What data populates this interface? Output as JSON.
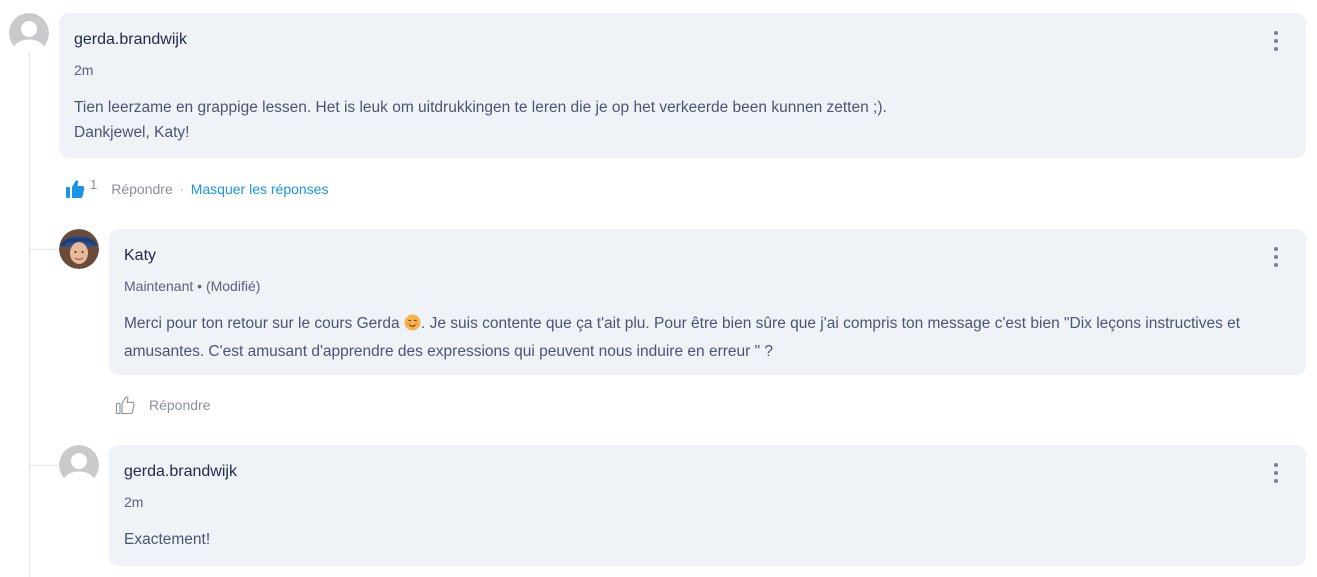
{
  "comments": [
    {
      "author": "gerda.brandwijk",
      "time": "2m",
      "text_line1": "Tien leerzame en grappige lessen. Het is leuk om uitdrukkingen te leren die je op het verkeerde been kunnen zetten ;).",
      "text_line2": "Dankjewel, Katy!",
      "like_count": "1",
      "reply_label": "Répondre",
      "separator": "·",
      "hide_replies_label": "Masquer les réponses"
    },
    {
      "author": "Katy",
      "time": "Maintenant • (Modifié)",
      "text_before_emoji": "Merci pour ton retour sur le cours Gerda ",
      "emoji": "smiling-face-emoji",
      "text_after_emoji": ". Je suis contente que ça t'ait plu. Pour être bien sûre que j'ai compris ton message c'est bien \"Dix leçons instructives et amusantes. C'est amusant d'apprendre des expressions qui peuvent nous induire en erreur \" ?",
      "reply_label": "Répondre"
    },
    {
      "author": "gerda.brandwijk",
      "time": "2m",
      "text": "Exactement!"
    }
  ],
  "colors": {
    "bubble": "#eff2f7",
    "link": "#1a93e8",
    "like_active": "#1a93e8",
    "muted": "#8b909d"
  }
}
